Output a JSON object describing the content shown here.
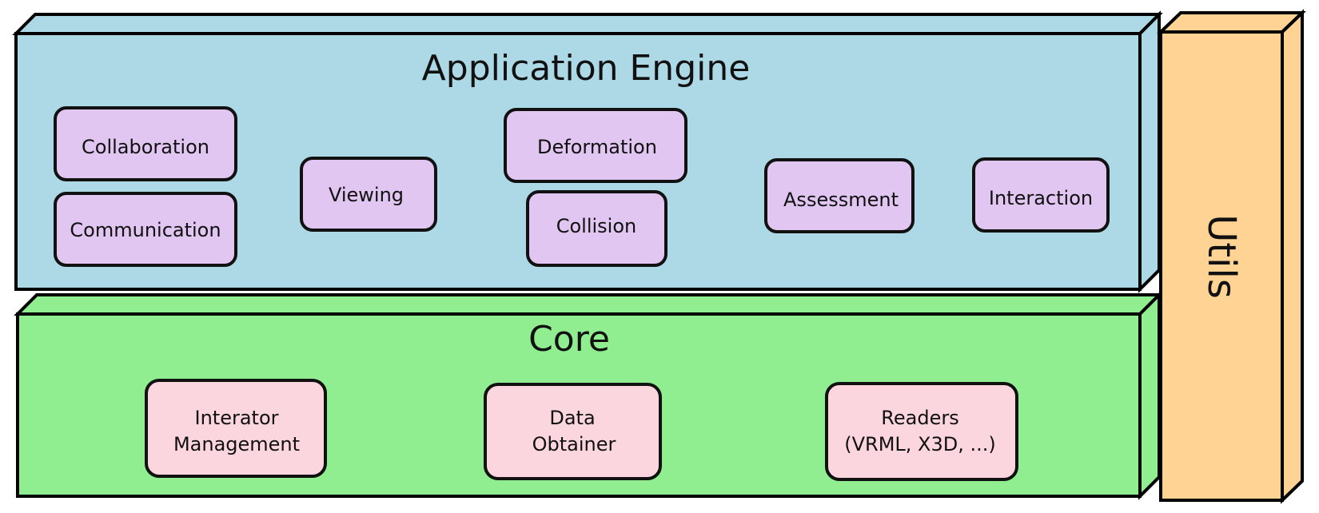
{
  "colors": {
    "application_engine": "#ADD8E6",
    "core": "#90EE90",
    "utils": "#FFD394",
    "app_module": "#E1C6F2",
    "core_module": "#FBD6DE",
    "outline": "#000000"
  },
  "application_engine": {
    "title": "Application Engine",
    "modules": {
      "collaboration": "Collaboration",
      "communication": "Communication",
      "viewing": "Viewing",
      "deformation": "Deformation",
      "collision": "Collision",
      "assessment": "Assessment",
      "interaction": "Interaction"
    }
  },
  "core": {
    "title": "Core",
    "modules": {
      "interator_management": [
        "Interator",
        "Management"
      ],
      "data_obtainer": [
        "Data",
        "Obtainer"
      ],
      "readers": [
        "Readers",
        "(VRML, X3D, ...)"
      ]
    }
  },
  "utils": {
    "title": "Utils"
  }
}
